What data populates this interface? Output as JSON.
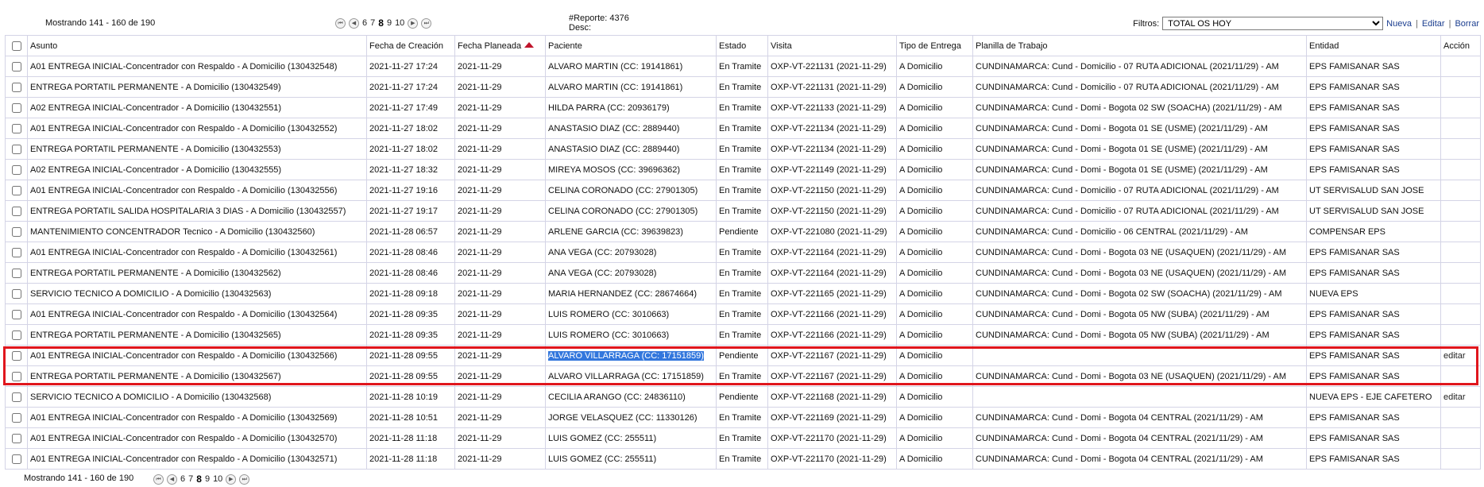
{
  "header": {
    "showing": "Mostrando 141 - 160 de 190",
    "report_label": "#Reporte: 4376",
    "desc_label": "Desc:",
    "filters_label": "Filtros:",
    "filter_selected": "TOTAL OS HOY",
    "nueva": "Nueva",
    "editar": "Editar",
    "borrar": "Borrar"
  },
  "pager": {
    "first": "⏮",
    "prev": "◀",
    "next": "▶",
    "last": "⏭",
    "pages": [
      "6",
      "7",
      "8",
      "9",
      "10"
    ],
    "current": "8"
  },
  "columns": {
    "asunto": "Asunto",
    "fecha_creacion": "Fecha de Creación",
    "fecha_planeada": "Fecha Planeada",
    "paciente": "Paciente",
    "estado": "Estado",
    "visita": "Visita",
    "tipo_entrega": "Tipo de Entrega",
    "planilla": "Planilla de Trabajo",
    "entidad": "Entidad",
    "accion": "Acción"
  },
  "rows": [
    {
      "asunto": "A01 ENTREGA INICIAL-Concentrador con Respaldo - A Domicilio (130432548)",
      "creacion": "2021-11-27 17:24",
      "planeada": "2021-11-29",
      "paciente": "ALVARO MARTIN (CC: 19141861)",
      "estado": "En Tramite",
      "visita": "OXP-VT-221131 (2021-11-29)",
      "tipo": "A Domicilio",
      "planilla": "CUNDINAMARCA: Cund - Domicilio - 07 RUTA ADICIONAL (2021/11/29) - AM",
      "entidad": "EPS FAMISANAR SAS",
      "accion": ""
    },
    {
      "asunto": "ENTREGA PORTATIL PERMANENTE - A Domicilio (130432549)",
      "creacion": "2021-11-27 17:24",
      "planeada": "2021-11-29",
      "paciente": "ALVARO MARTIN (CC: 19141861)",
      "estado": "En Tramite",
      "visita": "OXP-VT-221131 (2021-11-29)",
      "tipo": "A Domicilio",
      "planilla": "CUNDINAMARCA: Cund - Domicilio - 07 RUTA ADICIONAL (2021/11/29) - AM",
      "entidad": "EPS FAMISANAR SAS",
      "accion": ""
    },
    {
      "asunto": "A02 ENTREGA INICIAL-Concentrador - A Domicilio (130432551)",
      "creacion": "2021-11-27 17:49",
      "planeada": "2021-11-29",
      "paciente": "HILDA PARRA (CC: 20936179)",
      "estado": "En Tramite",
      "visita": "OXP-VT-221133 (2021-11-29)",
      "tipo": "A Domicilio",
      "planilla": "CUNDINAMARCA: Cund - Domi - Bogota 02 SW (SOACHA) (2021/11/29) - AM",
      "entidad": "EPS FAMISANAR SAS",
      "accion": ""
    },
    {
      "asunto": "A01 ENTREGA INICIAL-Concentrador con Respaldo - A Domicilio (130432552)",
      "creacion": "2021-11-27 18:02",
      "planeada": "2021-11-29",
      "paciente": "ANASTASIO DIAZ (CC: 2889440)",
      "estado": "En Tramite",
      "visita": "OXP-VT-221134 (2021-11-29)",
      "tipo": "A Domicilio",
      "planilla": "CUNDINAMARCA: Cund - Domi - Bogota 01 SE (USME) (2021/11/29) - AM",
      "entidad": "EPS FAMISANAR SAS",
      "accion": ""
    },
    {
      "asunto": "ENTREGA PORTATIL PERMANENTE - A Domicilio (130432553)",
      "creacion": "2021-11-27 18:02",
      "planeada": "2021-11-29",
      "paciente": "ANASTASIO DIAZ (CC: 2889440)",
      "estado": "En Tramite",
      "visita": "OXP-VT-221134 (2021-11-29)",
      "tipo": "A Domicilio",
      "planilla": "CUNDINAMARCA: Cund - Domi - Bogota 01 SE (USME) (2021/11/29) - AM",
      "entidad": "EPS FAMISANAR SAS",
      "accion": ""
    },
    {
      "asunto": "A02 ENTREGA INICIAL-Concentrador - A Domicilio (130432555)",
      "creacion": "2021-11-27 18:32",
      "planeada": "2021-11-29",
      "paciente": "MIREYA MOSOS (CC: 39696362)",
      "estado": "En Tramite",
      "visita": "OXP-VT-221149 (2021-11-29)",
      "tipo": "A Domicilio",
      "planilla": "CUNDINAMARCA: Cund - Domi - Bogota 01 SE (USME) (2021/11/29) - AM",
      "entidad": "EPS FAMISANAR SAS",
      "accion": ""
    },
    {
      "asunto": "A01 ENTREGA INICIAL-Concentrador con Respaldo - A Domicilio (130432556)",
      "creacion": "2021-11-27 19:16",
      "planeada": "2021-11-29",
      "paciente": "CELINA CORONADO (CC: 27901305)",
      "estado": "En Tramite",
      "visita": "OXP-VT-221150 (2021-11-29)",
      "tipo": "A Domicilio",
      "planilla": "CUNDINAMARCA: Cund - Domicilio - 07 RUTA ADICIONAL (2021/11/29) - AM",
      "entidad": "UT SERVISALUD SAN JOSE",
      "accion": ""
    },
    {
      "asunto": "ENTREGA PORTATIL SALIDA HOSPITALARIA 3 DIAS - A Domicilio (130432557)",
      "creacion": "2021-11-27 19:17",
      "planeada": "2021-11-29",
      "paciente": "CELINA CORONADO (CC: 27901305)",
      "estado": "En Tramite",
      "visita": "OXP-VT-221150 (2021-11-29)",
      "tipo": "A Domicilio",
      "planilla": "CUNDINAMARCA: Cund - Domicilio - 07 RUTA ADICIONAL (2021/11/29) - AM",
      "entidad": "UT SERVISALUD SAN JOSE",
      "accion": ""
    },
    {
      "asunto": "MANTENIMIENTO CONCENTRADOR Tecnico - A Domicilio (130432560)",
      "creacion": "2021-11-28 06:57",
      "planeada": "2021-11-29",
      "paciente": "ARLENE GARCIA (CC: 39639823)",
      "estado": "Pendiente",
      "visita": "OXP-VT-221080 (2021-11-29)",
      "tipo": "A Domicilio",
      "planilla": "CUNDINAMARCA: Cund - Domicilio - 06 CENTRAL (2021/11/29) - AM",
      "entidad": "COMPENSAR EPS",
      "accion": ""
    },
    {
      "asunto": "A01 ENTREGA INICIAL-Concentrador con Respaldo - A Domicilio (130432561)",
      "creacion": "2021-11-28 08:46",
      "planeada": "2021-11-29",
      "paciente": "ANA VEGA (CC: 20793028)",
      "estado": "En Tramite",
      "visita": "OXP-VT-221164 (2021-11-29)",
      "tipo": "A Domicilio",
      "planilla": "CUNDINAMARCA: Cund - Domi - Bogota 03 NE (USAQUEN) (2021/11/29) - AM",
      "entidad": "EPS FAMISANAR SAS",
      "accion": ""
    },
    {
      "asunto": "ENTREGA PORTATIL PERMANENTE - A Domicilio (130432562)",
      "creacion": "2021-11-28 08:46",
      "planeada": "2021-11-29",
      "paciente": "ANA VEGA (CC: 20793028)",
      "estado": "En Tramite",
      "visita": "OXP-VT-221164 (2021-11-29)",
      "tipo": "A Domicilio",
      "planilla": "CUNDINAMARCA: Cund - Domi - Bogota 03 NE (USAQUEN) (2021/11/29) - AM",
      "entidad": "EPS FAMISANAR SAS",
      "accion": ""
    },
    {
      "asunto": "SERVICIO TECNICO A DOMICILIO - A Domicilio (130432563)",
      "creacion": "2021-11-28 09:18",
      "planeada": "2021-11-29",
      "paciente": "MARIA HERNANDEZ (CC: 28674664)",
      "estado": "En Tramite",
      "visita": "OXP-VT-221165 (2021-11-29)",
      "tipo": "A Domicilio",
      "planilla": "CUNDINAMARCA: Cund - Domi - Bogota 02 SW (SOACHA) (2021/11/29) - AM",
      "entidad": "NUEVA EPS",
      "accion": ""
    },
    {
      "asunto": "A01 ENTREGA INICIAL-Concentrador con Respaldo - A Domicilio (130432564)",
      "creacion": "2021-11-28 09:35",
      "planeada": "2021-11-29",
      "paciente": "LUIS ROMERO (CC: 3010663)",
      "estado": "En Tramite",
      "visita": "OXP-VT-221166 (2021-11-29)",
      "tipo": "A Domicilio",
      "planilla": "CUNDINAMARCA: Cund - Domi - Bogota 05 NW (SUBA) (2021/11/29) - AM",
      "entidad": "EPS FAMISANAR SAS",
      "accion": ""
    },
    {
      "asunto": "ENTREGA PORTATIL PERMANENTE - A Domicilio (130432565)",
      "creacion": "2021-11-28 09:35",
      "planeada": "2021-11-29",
      "paciente": "LUIS ROMERO (CC: 3010663)",
      "estado": "En Tramite",
      "visita": "OXP-VT-221166 (2021-11-29)",
      "tipo": "A Domicilio",
      "planilla": "CUNDINAMARCA: Cund - Domi - Bogota 05 NW (SUBA) (2021/11/29) - AM",
      "entidad": "EPS FAMISANAR SAS",
      "accion": ""
    },
    {
      "asunto": "A01 ENTREGA INICIAL-Concentrador con Respaldo - A Domicilio (130432566)",
      "creacion": "2021-11-28 09:55",
      "planeada": "2021-11-29",
      "paciente": "ALVARO VILLARRAGA (CC: 17151859)",
      "estado": "Pendiente",
      "visita": "OXP-VT-221167 (2021-11-29)",
      "tipo": "A Domicilio",
      "planilla": "",
      "entidad": "EPS FAMISANAR SAS",
      "accion": "editar",
      "selected": true
    },
    {
      "asunto": "ENTREGA PORTATIL PERMANENTE - A Domicilio (130432567)",
      "creacion": "2021-11-28 09:55",
      "planeada": "2021-11-29",
      "paciente": "ALVARO VILLARRAGA (CC: 17151859)",
      "estado": "En Tramite",
      "visita": "OXP-VT-221167 (2021-11-29)",
      "tipo": "A Domicilio",
      "planilla": "CUNDINAMARCA: Cund - Domi - Bogota 03 NE (USAQUEN) (2021/11/29) - AM",
      "entidad": "EPS FAMISANAR SAS",
      "accion": ""
    },
    {
      "asunto": "SERVICIO TECNICO A DOMICILIO - A Domicilio (130432568)",
      "creacion": "2021-11-28 10:19",
      "planeada": "2021-11-29",
      "paciente": "CECILIA ARANGO (CC: 24836110)",
      "estado": "Pendiente",
      "visita": "OXP-VT-221168 (2021-11-29)",
      "tipo": "A Domicilio",
      "planilla": "",
      "entidad": "NUEVA EPS - EJE CAFETERO",
      "accion": "editar"
    },
    {
      "asunto": "A01 ENTREGA INICIAL-Concentrador con Respaldo - A Domicilio (130432569)",
      "creacion": "2021-11-28 10:51",
      "planeada": "2021-11-29",
      "paciente": "JORGE VELASQUEZ (CC: 11330126)",
      "estado": "En Tramite",
      "visita": "OXP-VT-221169 (2021-11-29)",
      "tipo": "A Domicilio",
      "planilla": "CUNDINAMARCA: Cund - Domi - Bogota 04 CENTRAL (2021/11/29) - AM",
      "entidad": "EPS FAMISANAR SAS",
      "accion": ""
    },
    {
      "asunto": "A01 ENTREGA INICIAL-Concentrador con Respaldo - A Domicilio (130432570)",
      "creacion": "2021-11-28 11:18",
      "planeada": "2021-11-29",
      "paciente": "LUIS GOMEZ (CC: 255511)",
      "estado": "En Tramite",
      "visita": "OXP-VT-221170 (2021-11-29)",
      "tipo": "A Domicilio",
      "planilla": "CUNDINAMARCA: Cund - Domi - Bogota 04 CENTRAL (2021/11/29) - AM",
      "entidad": "EPS FAMISANAR SAS",
      "accion": ""
    },
    {
      "asunto": "A01 ENTREGA INICIAL-Concentrador con Respaldo - A Domicilio (130432571)",
      "creacion": "2021-11-28 11:18",
      "planeada": "2021-11-29",
      "paciente": "LUIS GOMEZ (CC: 255511)",
      "estado": "En Tramite",
      "visita": "OXP-VT-221170 (2021-11-29)",
      "tipo": "A Domicilio",
      "planilla": "CUNDINAMARCA: Cund - Domi - Bogota 04 CENTRAL (2021/11/29) - AM",
      "entidad": "EPS FAMISANAR SAS",
      "accion": ""
    }
  ],
  "colors": {
    "highlight_border": "#e0161d",
    "text_selection": "#3377dd",
    "sort_arrow": "#c0142b",
    "grid_border": "#d4d4e6"
  }
}
